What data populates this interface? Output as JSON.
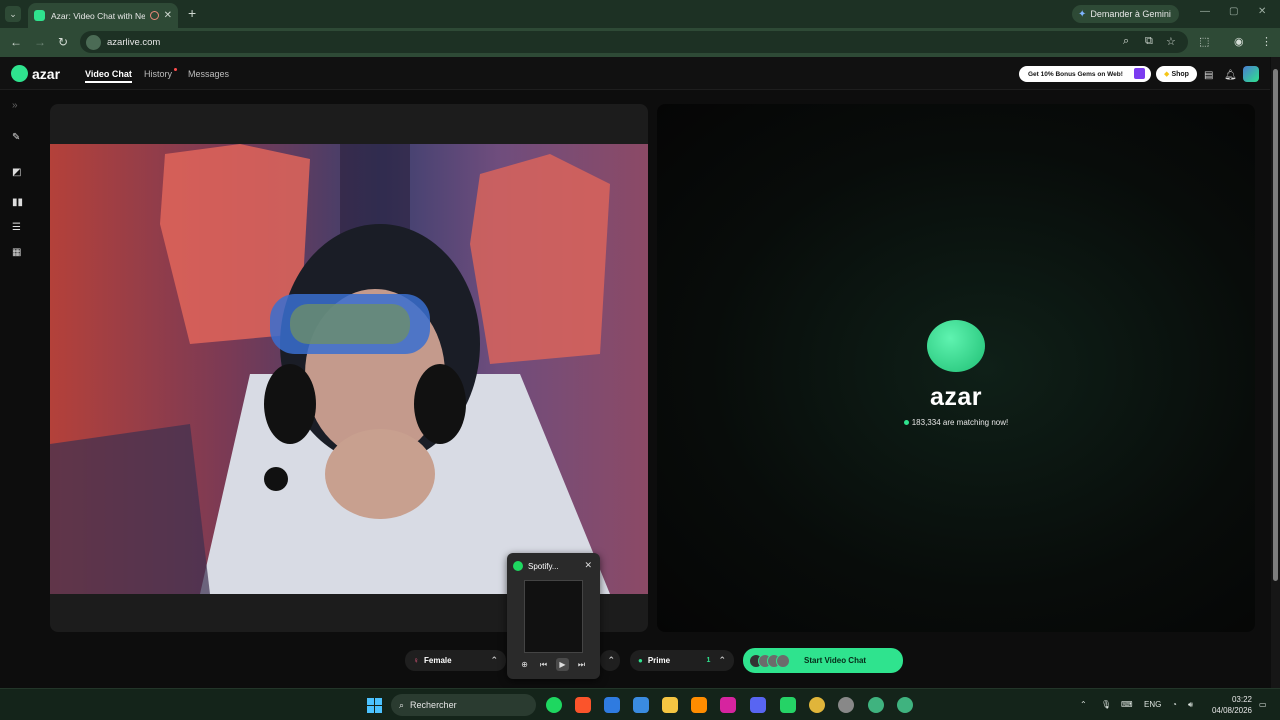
{
  "browser": {
    "tab_title": "Azar: Video Chat with New",
    "tab_close": "✕",
    "new_tab": "+",
    "gemini_label": "Demander à Gemini",
    "url": "azarlive.com"
  },
  "header": {
    "logo": "azar",
    "nav": [
      "Video Chat",
      "History",
      "Messages"
    ],
    "promo": "Get 10% Bonus Gems on Web!",
    "shop": "Shop"
  },
  "match": {
    "brand": "azar",
    "count_text": "183,334 are matching now!"
  },
  "controls": {
    "gender_label": "Female",
    "prime_label": "Prime",
    "prime_badge": "1",
    "start_label": "Start Video Chat"
  },
  "spotify": {
    "title": "Spotify..."
  },
  "taskbar": {
    "search_placeholder": "Rechercher",
    "lang": "ENG",
    "time": "03:22",
    "date": "04/08/2026"
  },
  "colors": {
    "accent": "#2fe38e",
    "browser_frame": "#1d3124",
    "page_bg": "#0d0d0d"
  }
}
